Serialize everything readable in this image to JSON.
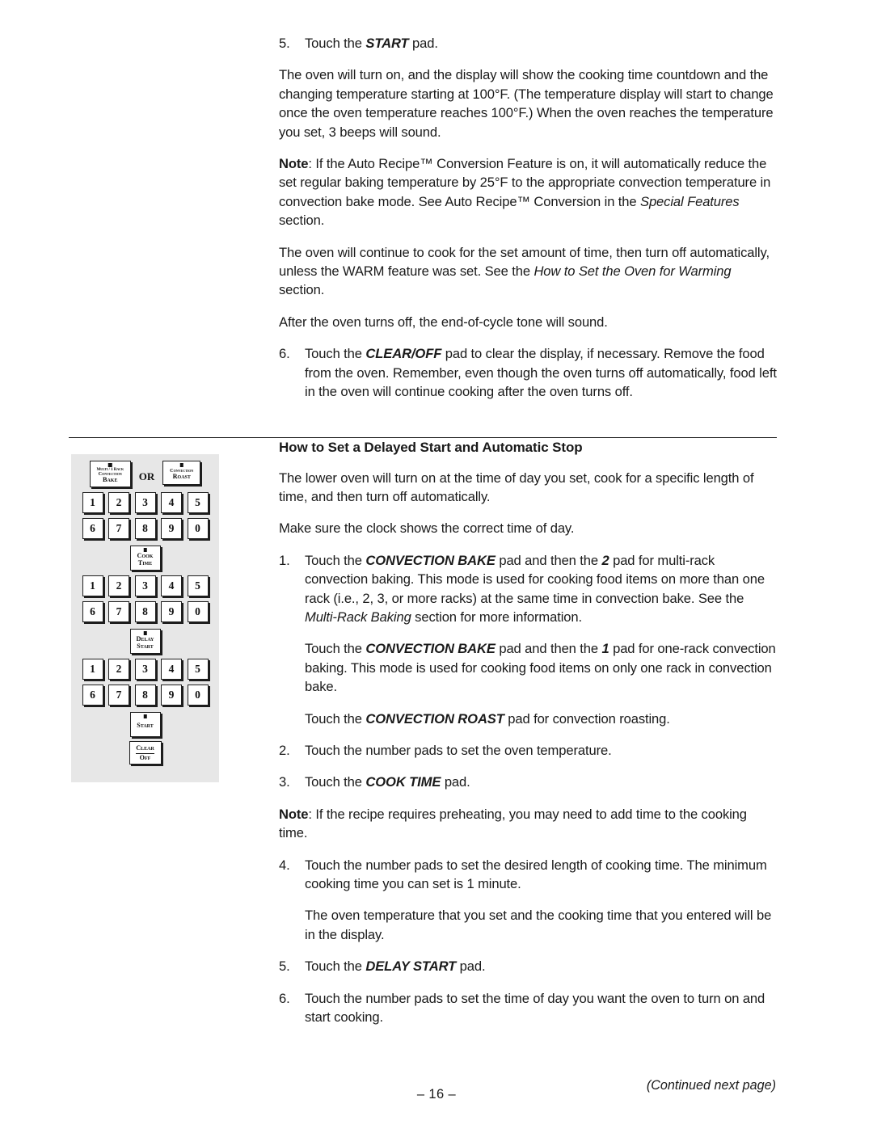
{
  "page": {
    "number_label": "– 16 –",
    "continued_label": "(Continued next page)"
  },
  "top_section": {
    "step5": {
      "num": "5.",
      "pre": "Touch the ",
      "bold": "START",
      "post": " pad."
    },
    "para_oven_turn_on": "The oven will turn on, and the display will show the cooking time countdown and the changing temperature starting at 100°F. (The temperature display will start to change once the oven temperature reaches 100°F.) When the oven reaches the temperature you set, 3 beeps will sound.",
    "note_auto_recipe": {
      "label": "Note",
      "part1": ": If the Auto Recipe™ Conversion Feature is on, it will automatically reduce the set regular baking temperature by 25°F to the appropriate convection temperature in convection bake mode. See Auto Recipe™ Conversion in the ",
      "italic": "Special Features",
      "part2": " section."
    },
    "para_continue_cook": {
      "part1": "The oven will continue to cook for the set amount of time, then turn off automatically, unless the WARM feature was set. See the ",
      "italic": "How to Set the Oven for Warming",
      "part2": " section."
    },
    "para_end_of_cycle": "After the oven turns off, the end-of-cycle tone will sound.",
    "step6": {
      "num": "6.",
      "pre": "Touch the ",
      "bold": "CLEAR/OFF",
      "post": " pad to clear the display, if necessary. Remove the food from the oven. Remember, even though the oven turns off automatically, food left in the oven will continue cooking after the oven turns off."
    }
  },
  "delayed_section": {
    "title": "How to Set a Delayed Start and Automatic Stop",
    "intro": "The lower oven will turn on at the time of day you set, cook for a specific length of time, and then turn off automatically.",
    "clock_note": "Make sure the clock shows the correct time of day.",
    "step1": {
      "num": "1.",
      "pre": "Touch the ",
      "bold1": "CONVECTION BAKE",
      "mid": " pad and then the ",
      "bold2": "2",
      "post1": " pad for multi-rack convection baking. This mode is used for cooking food items on more than one rack (i.e., 2, 3, or more racks) at the same time in convection bake. See the ",
      "italic": "Multi-Rack Baking",
      "post2": " section for more information."
    },
    "step1_sub1": {
      "pre": "Touch the ",
      "bold1": "CONVECTION BAKE",
      "mid": " pad and then the ",
      "bold2": "1",
      "post": " pad for one-rack convection baking. This mode is used for cooking food items on only one rack in convection bake."
    },
    "step1_sub2": {
      "pre": "Touch the ",
      "bold": "CONVECTION ROAST",
      "post": " pad for convection roasting."
    },
    "step2": {
      "num": "2.",
      "text": "Touch the number pads to set the oven temperature."
    },
    "step3": {
      "num": "3.",
      "pre": "Touch the ",
      "bold": "COOK TIME",
      "post": " pad."
    },
    "note_preheat": {
      "label": "Note",
      "text": ": If the recipe requires preheating, you may need to add time to the cooking time."
    },
    "step4": {
      "num": "4.",
      "text": "Touch the number pads to set the desired length of cooking time. The minimum cooking time you can set is 1 minute."
    },
    "step4_sub": "The oven temperature that you set and the cooking time that you entered will be in the display.",
    "step5": {
      "num": "5.",
      "pre": "Touch the ",
      "bold": "DELAY START",
      "post": " pad."
    },
    "step6": {
      "num": "6.",
      "text": "Touch the number pads to set the time of day you want the oven to turn on and start cooking."
    }
  },
  "control_panel": {
    "or_label": "OR",
    "convection_bake": {
      "line1": "Multi / 1 Rack",
      "line2": "Convection",
      "line3": "Bake"
    },
    "convection_roast": {
      "line1": "Convection",
      "line2": "Roast"
    },
    "cook_time": {
      "line1": "Cook",
      "line2": "Time"
    },
    "delay_start": {
      "line1": "Delay",
      "line2": "Start"
    },
    "start": {
      "line1": "Start"
    },
    "clear_off": {
      "line1": "Clear",
      "line2": "Off"
    },
    "keypad_row_top": [
      "1",
      "2",
      "3",
      "4",
      "5"
    ],
    "keypad_row_bottom": [
      "6",
      "7",
      "8",
      "9",
      "0"
    ]
  }
}
